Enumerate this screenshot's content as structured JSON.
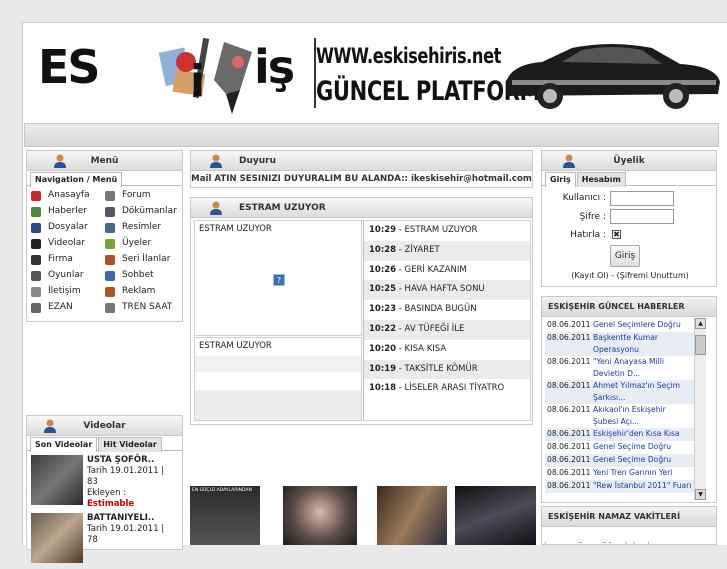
{
  "banner": {
    "logo_left": "ES",
    "logo_mid": "i",
    "logo_right": "iş",
    "url": "WWW.eskisehiris.net",
    "subtitle": "GÜNCEL PLATFORM"
  },
  "menu": {
    "title": "Menü",
    "tab": "Navigation / Menü",
    "items_left": [
      "Anasayfa",
      "Haberler",
      "Dosyalar",
      "Videolar",
      "Firma",
      "Oyunlar",
      "İletişim",
      "EZAN"
    ],
    "items_right": [
      "Forum",
      "Dökümanlar",
      "Resimler",
      "Üyeler",
      "Seri İlanlar",
      "Sohbet",
      "Reklam",
      "TREN SAAT"
    ]
  },
  "duyuru": {
    "title": "Duyuru",
    "text": "Mail ATIN SESINIZI DUYURALIM BU ALANDA:: ikeskisehir@hotmail.com"
  },
  "estram": {
    "title": "ESTRAM UZUYOR",
    "top_label": "ESTRAM UZUYOR",
    "bottom_label": "ESTRAM UZUYOR",
    "broken_image": "?",
    "items": [
      {
        "time": "10:29",
        "text": "ESTRAM UZUYOR"
      },
      {
        "time": "10:28",
        "text": "ZİYARET"
      },
      {
        "time": "10:26",
        "text": "GERİ KAZANIM"
      },
      {
        "time": "10:25",
        "text": "HAVA HAFTA SONU"
      },
      {
        "time": "10:23",
        "text": "BASINDA BUGÜN"
      },
      {
        "time": "10:22",
        "text": "AV TÜFEĞİ İLE"
      },
      {
        "time": "10:20",
        "text": "KISA KISA"
      },
      {
        "time": "10:19",
        "text": "TAKSİTLE KÖMÜR"
      },
      {
        "time": "10:18",
        "text": "LİSELER ARASI TİYATRO"
      }
    ]
  },
  "uyelik": {
    "title": "Üyelik",
    "tab_login": "Giriş",
    "tab_account": "Hesabım",
    "username_label": "Kullanıcı",
    "password_label": "Şifre",
    "remember_label": "Hatırla",
    "login_button": "Giriş",
    "links": "(Kayıt Ol) - (Şifremi Unuttum)"
  },
  "haberler": {
    "title": "ESKİŞEHİR GÜNCEL HABERLER",
    "items": [
      {
        "date": "08.06.2011",
        "text": "Genel Seçimlere Doğru"
      },
      {
        "date": "08.06.2011",
        "text": "Başkentte Kumar Operasyonu"
      },
      {
        "date": "08.06.2011",
        "text": "\"Yeni Anayasa Milli Devletin D..."
      },
      {
        "date": "08.06.2011",
        "text": "Ahmet Yılmaz'ın Seçim Şarkısı..."
      },
      {
        "date": "08.06.2011",
        "text": "Akıkaol'ın Eskişehir Şubesi Açı..."
      },
      {
        "date": "08.06.2011",
        "text": "Eskişehir'den Kısa Kısa"
      },
      {
        "date": "08.06.2011",
        "text": "Genel Seçime Doğru"
      },
      {
        "date": "08.06.2011",
        "text": "Genel Seçime Doğru"
      },
      {
        "date": "08.06.2011",
        "text": "Yeni Tren Garının Yeri"
      },
      {
        "date": "08.06.2011",
        "text": "\"Rew İstanbul 2011\" Fuarı"
      }
    ]
  },
  "namaz": {
    "title": "ESKİŞEHİR NAMAZ VAKİTLERİ",
    "row": "İMSAK GÜNEŞ ÖĞLE İKİNDİ AKŞAM YATSI"
  },
  "videolar": {
    "title": "Videolar",
    "tab_recent": "Son Videolar",
    "tab_hit": "Hit Videolar",
    "items": [
      {
        "title": "USTA ŞOFÖR..",
        "date": "Tarih 19.01.2011 |",
        "views": "83",
        "added_label": "Ekleyen :",
        "uploader": "Estimable"
      },
      {
        "title": "BATTANIYELI..",
        "date": "Tarih 19.01.2011 |",
        "views": "78"
      }
    ]
  },
  "posters": {
    "caption": "EN GÜÇLÜ ADAYLARINDAN"
  },
  "colors": {
    "accent_red": "#c00000",
    "link_blue": "#1a3c9c",
    "row_alt": "#ebebeb"
  }
}
